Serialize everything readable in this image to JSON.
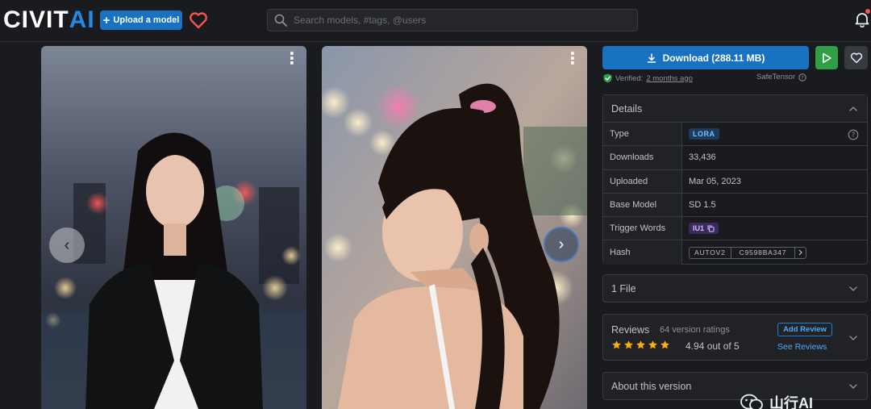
{
  "header": {
    "logo_main": "CIVIT",
    "logo_accent": "AI",
    "upload_label": "Upload a model",
    "search_placeholder": "Search models, #tags, @users"
  },
  "gallery": {
    "prev_label": "‹",
    "next_label": "›",
    "menu_label": "⋮"
  },
  "download": {
    "label": "Download (288.11 MB)"
  },
  "verified": {
    "prefix": "Verified:",
    "when": "2 months ago",
    "format": "SafeTensor"
  },
  "details": {
    "title": "Details",
    "rows": {
      "type": {
        "key": "Type",
        "value": "LORA"
      },
      "downloads": {
        "key": "Downloads",
        "value": "33,436"
      },
      "uploaded": {
        "key": "Uploaded",
        "value": "Mar 05, 2023"
      },
      "base_model": {
        "key": "Base Model",
        "value": "SD 1.5"
      },
      "trigger": {
        "key": "Trigger Words",
        "value": "IU1"
      },
      "hash": {
        "key": "Hash",
        "algorithm": "AUTOV2",
        "value": "C9598BA347"
      }
    }
  },
  "files": {
    "label": "1 File"
  },
  "reviews": {
    "title": "Reviews",
    "count": "64 version ratings",
    "score": "4.94 out of 5",
    "stars": 5,
    "add_label": "Add Review",
    "see_label": "See Reviews"
  },
  "about": {
    "label": "About this version"
  },
  "watermark": {
    "text": "山行AI"
  },
  "colors": {
    "accent": "#1971c2",
    "play": "#2f9e44",
    "star": "#fab005",
    "heart": "#fa5252"
  }
}
